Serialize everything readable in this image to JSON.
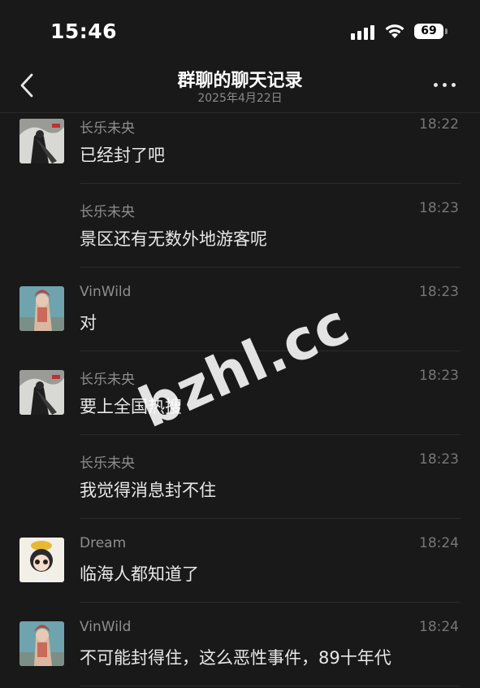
{
  "status_bar": {
    "time": "15:46",
    "battery": "69"
  },
  "header": {
    "title": "群聊的聊天记录",
    "subtitle": "2025年4月22日"
  },
  "messages": [
    {
      "sender": "长乐未央",
      "time": "18:22",
      "text": "已经封了吧",
      "avatar": "ink-painting-avatar"
    },
    {
      "sender": "长乐未央",
      "time": "18:23",
      "text": "景区还有无数外地游客呢",
      "avatar": ""
    },
    {
      "sender": "VinWild",
      "time": "18:23",
      "text": "对",
      "avatar": "illustrated-figure-avatar"
    },
    {
      "sender": "长乐未央",
      "time": "18:23",
      "text": "要上全国热搜",
      "avatar": "ink-painting-avatar"
    },
    {
      "sender": "长乐未央",
      "time": "18:23",
      "text": "我觉得消息封不住",
      "avatar": ""
    },
    {
      "sender": "Dream",
      "time": "18:24",
      "text": "临海人都知道了",
      "avatar": "cartoon-girl-avatar"
    },
    {
      "sender": "VinWild",
      "time": "18:24",
      "text": "不可能封得住，这么恶性事件，89十年代",
      "avatar": "illustrated-figure-avatar"
    }
  ],
  "watermark": "bzhl.cc",
  "colors": {
    "background": "#191919",
    "text": "#e8e8e8",
    "secondary_text": "#8e8e8e",
    "divider": "#2c2c2c"
  }
}
